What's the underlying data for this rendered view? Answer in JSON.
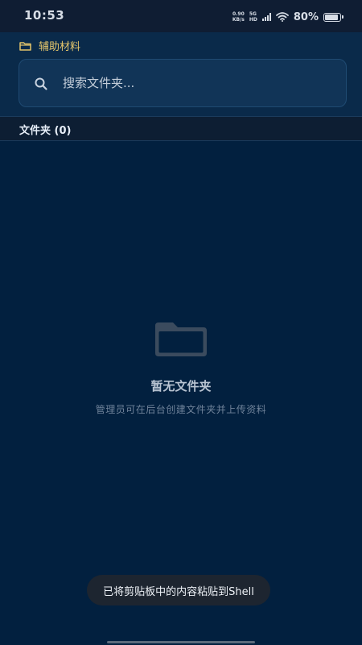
{
  "status_bar": {
    "time": "10:53",
    "net_speed_value": "0.90",
    "net_speed_unit": "KB/s",
    "network_type": "5G",
    "network_sub": "HD",
    "battery": "80%"
  },
  "breadcrumb": {
    "label": "辅助材料",
    "icon": "folder-icon"
  },
  "search": {
    "placeholder": "搜索文件夹...",
    "value": "",
    "icon": "search-icon"
  },
  "section": {
    "title": "文件夹 (0)"
  },
  "empty_state": {
    "icon": "folder-icon",
    "title": "暂无文件夹",
    "subtitle": "管理员可在后台创建文件夹并上传资料"
  },
  "toast": {
    "text": "已将剪贴板中的内容粘贴到Shell"
  },
  "colors": {
    "background": "#02203f",
    "accent": "#e4c56b",
    "toast_bg": "#1d2530"
  }
}
